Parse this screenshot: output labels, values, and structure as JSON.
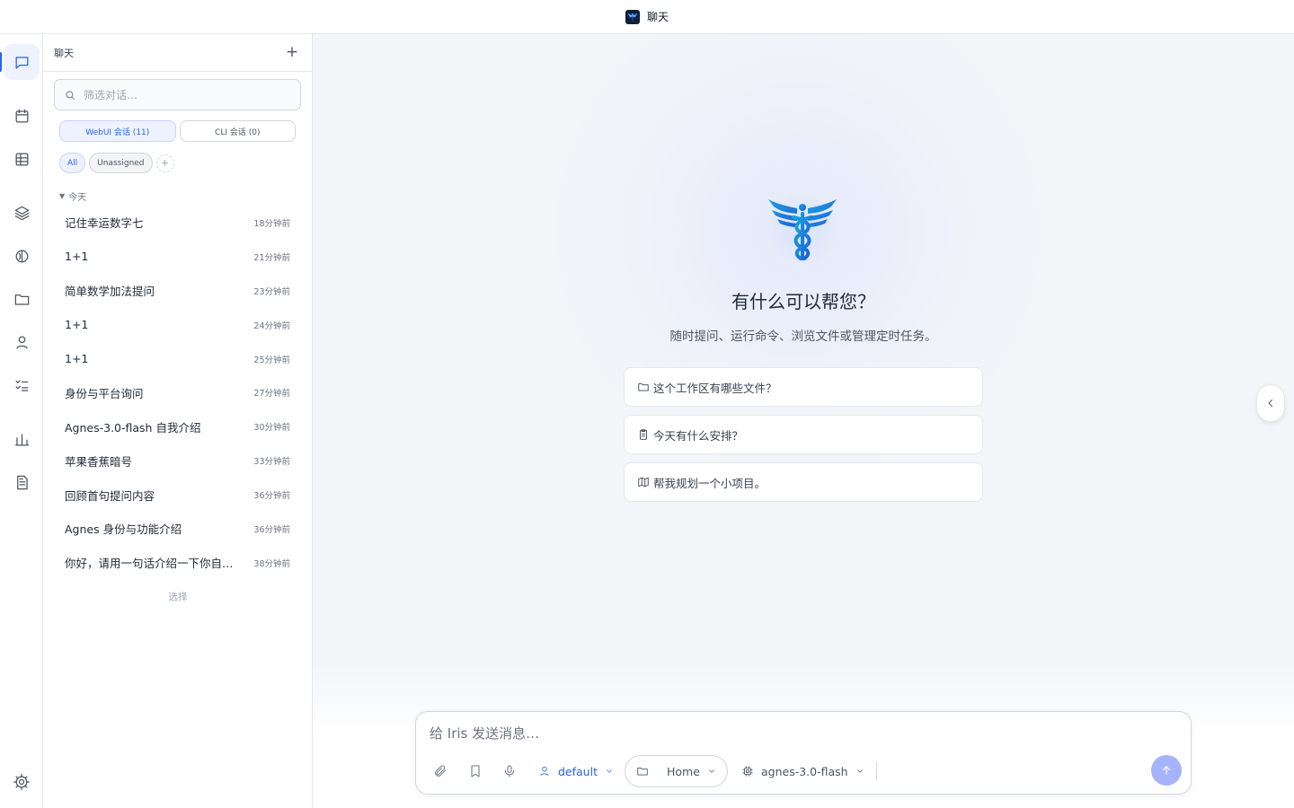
{
  "window": {
    "title": "聊天",
    "logo_icon": "app-logo-icon"
  },
  "rail": {
    "items": [
      {
        "name": "chat",
        "icon": "chat-icon",
        "active": true
      },
      {
        "name": "calendar",
        "icon": "calendar-icon"
      },
      {
        "name": "grid",
        "icon": "table-icon"
      },
      {
        "name": "layers",
        "icon": "layers-icon"
      },
      {
        "name": "brain",
        "icon": "brain-icon"
      },
      {
        "name": "folder",
        "icon": "folder-icon"
      },
      {
        "name": "user",
        "icon": "user-icon"
      },
      {
        "name": "tasks",
        "icon": "checklist-icon"
      },
      {
        "name": "stats",
        "icon": "bar-chart-icon"
      },
      {
        "name": "docs",
        "icon": "document-icon"
      }
    ],
    "settings_icon": "gear-icon"
  },
  "sessions": {
    "header_title": "聊天",
    "new_label": "+",
    "search_placeholder": "筛选对话…",
    "tabs": [
      {
        "label": "WebUI 会话 (11)",
        "active": true
      },
      {
        "label": "CLI 会话 (0)",
        "active": false
      }
    ],
    "chips": [
      {
        "label": "All",
        "active": true
      },
      {
        "label": "Unassigned",
        "active": false
      },
      {
        "label": "+",
        "active": false
      }
    ],
    "group_label": "今天",
    "items": [
      {
        "title": "记住幸运数字七",
        "time": "18分钟前"
      },
      {
        "title": "1+1",
        "time": "21分钟前"
      },
      {
        "title": "简单数学加法提问",
        "time": "23分钟前"
      },
      {
        "title": "1+1",
        "time": "24分钟前"
      },
      {
        "title": "1+1",
        "time": "25分钟前"
      },
      {
        "title": "身份与平台询问",
        "time": "27分钟前"
      },
      {
        "title": "Agnes-3.0-flash 自我介绍",
        "time": "30分钟前"
      },
      {
        "title": "苹果香蕉暗号",
        "time": "33分钟前"
      },
      {
        "title": "回顾首句提问内容",
        "time": "36分钟前"
      },
      {
        "title": "Agnes 身份与功能介绍",
        "time": "36分钟前"
      },
      {
        "title": "你好，请用一句话介绍一下你自…",
        "time": "38分钟前"
      }
    ],
    "select_label": "选择"
  },
  "main": {
    "hero_title": "有什么可以帮您？",
    "hero_subtitle": "随时提问、运行命令、浏览文件或管理定时任务。",
    "suggestions": [
      {
        "icon": "folder-icon",
        "label": "这个工作区有哪些文件？"
      },
      {
        "icon": "clipboard-icon",
        "label": "今天有什么安排？"
      },
      {
        "icon": "map-icon",
        "label": "帮我规划一个小项目。"
      }
    ]
  },
  "composer": {
    "placeholder": "给 Iris 发送消息…",
    "persona": "default",
    "folder": "Home",
    "model": "agnes-3.0-flash"
  },
  "colors": {
    "accent": "#2563eb",
    "accent_soft": "#eef2ff",
    "send_disabled": "#a5b4fc",
    "logo_blue": "#1e6fd9"
  }
}
